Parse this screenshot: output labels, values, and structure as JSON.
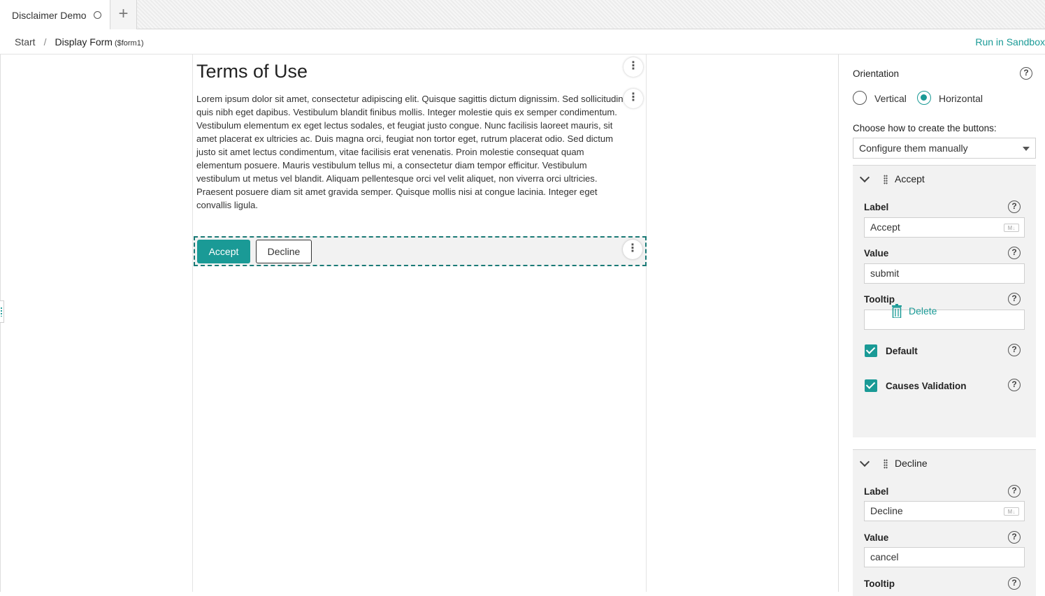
{
  "tabs": [
    {
      "label": "Disclaimer Demo"
    }
  ],
  "breadcrumb": {
    "start": "Start",
    "separator": "/",
    "current": "Display Form",
    "form_id": "($form1)"
  },
  "header": {
    "run_link": "Run in Sandbox"
  },
  "form": {
    "title": "Terms of Use",
    "body": "Lorem ipsum dolor sit amet, consectetur adipiscing elit. Quisque sagittis dictum dignissim. Sed sollicitudin quis nibh eget dapibus. Vestibulum blandit finibus mollis. Integer molestie quis ex semper condimentum. Vestibulum elementum ex eget lectus sodales, et feugiat justo congue. Nunc facilisis laoreet mauris, sit amet placerat ex ultricies ac. Duis magna orci, feugiat non tortor eget, rutrum placerat odio. Sed dictum justo sit amet lectus condimentum, vitae facilisis erat venenatis. Proin molestie consequat quam elementum posuere. Mauris vestibulum tellus mi, a consectetur diam tempor efficitur. Vestibulum vestibulum ut metus vel blandit. Aliquam pellentesque orci vel velit aliquet, non viverra orci ultricies. Praesent posuere diam sit amet gravida semper. Quisque mollis nisi at congue lacinia. Integer eget convallis ligula.",
    "accept_button": "Accept",
    "decline_button": "Decline"
  },
  "panel": {
    "orientation_label": "Orientation",
    "orientation_options": [
      "Vertical",
      "Horizontal"
    ],
    "orientation_selected": "Horizontal",
    "create_label": "Choose how to create the buttons:",
    "create_value": "Configure them manually",
    "buttons": [
      {
        "title": "Accept",
        "label_caption": "Label",
        "label_value": "Accept",
        "value_caption": "Value",
        "value_value": "submit",
        "tooltip_caption": "Tooltip",
        "tooltip_value": "",
        "default_caption": "Default",
        "default_checked": true,
        "validation_caption": "Causes Validation",
        "validation_checked": true,
        "delete_label": "Delete"
      },
      {
        "title": "Decline",
        "label_caption": "Label",
        "label_value": "Decline",
        "value_caption": "Value",
        "value_value": "cancel",
        "tooltip_caption": "Tooltip"
      }
    ],
    "help_glyph": "?",
    "markdown_badge": "M↓"
  },
  "colors": {
    "accent": "#1a9a96",
    "panel_bg": "#f2f2f2"
  }
}
